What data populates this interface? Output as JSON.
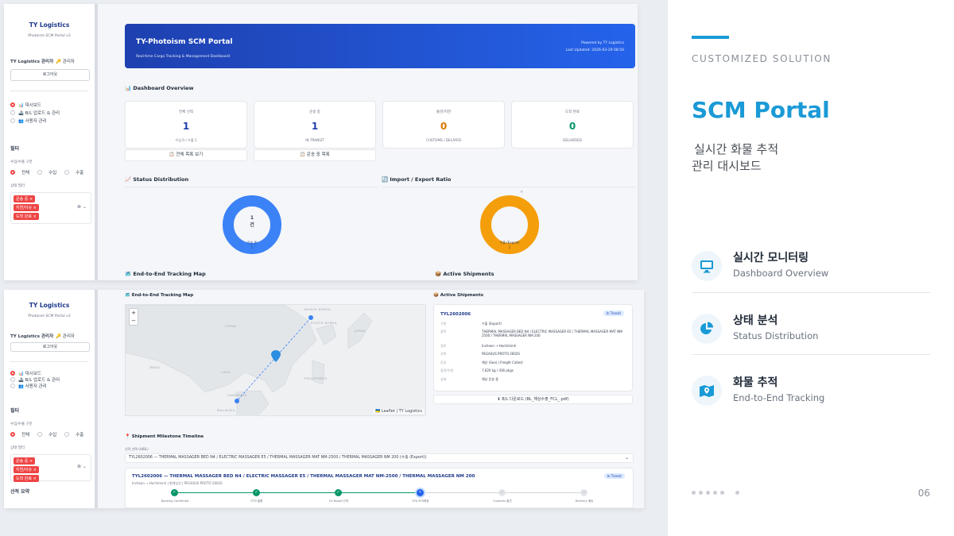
{
  "slide": {
    "eyebrow": "CUSTOMIZED SOLUTION",
    "title": "SCM Portal",
    "desc_line1": "실시간 화물 추적",
    "desc_line2": "관리 대시보드",
    "page_number": "06",
    "accent_color": "#1a9ad6",
    "features": [
      {
        "icon": "monitor-icon",
        "title": "실시간 모니터링",
        "subtitle": "Dashboard Overview"
      },
      {
        "icon": "pie-chart-icon",
        "title": "상태 분석",
        "subtitle": "Status Distribution"
      },
      {
        "icon": "map-icon",
        "title": "화물 추적",
        "subtitle": "End-to-End Tracking"
      }
    ]
  },
  "sidebar": {
    "brand": "TY Logistics",
    "subtitle": "Photoism SCM Portal v3",
    "subtitle2": "Photoism SCM Portal v3",
    "user": "TY Logistics 관리자",
    "role": "🔑 관리자",
    "logout": "로그아웃",
    "nav": [
      "📊 대시보드",
      "🚢 B/L 업로드 & 관리",
      "👥 사용자 관리"
    ],
    "filter_title": "필터",
    "io_label": "수입/수출 구분",
    "io_options": [
      "전체",
      "수입",
      "수출"
    ],
    "status_label": "상태 필터",
    "status_tags": [
      "운송 중 ×",
      "지연/이슈 ×",
      "도착 완료 ×"
    ],
    "next_section": "선적 요약"
  },
  "dashboard": {
    "banner_title": "TY-Photoism SCM Portal",
    "banner_subtitle": "Real-time Cargo Tracking & Management Dashboard",
    "powered_by": "Powered by TY Logistics",
    "last_updated": "Last Updated: 2026-03-29 08:50",
    "overview_title": "📊 Dashboard Overview",
    "cards": [
      {
        "label": "전체 선적",
        "value": "1",
        "sub": "수입 0 / 수출 1"
      },
      {
        "label": "운송 중",
        "value": "1",
        "sub": "IN TRANSIT"
      },
      {
        "label": "통관/지연",
        "value": "0",
        "sub": "CUSTOMS / DELAYED"
      },
      {
        "label": "도착 완료",
        "value": "0",
        "sub": "DELIVERED"
      }
    ],
    "btn_all": "📋 전체 목록 보기",
    "btn_transit": "📋 운송 중 목록",
    "status_title": "📈 Status Distribution",
    "ratio_title": "🔄 Import / Export Ratio",
    "donut_center_top": "1",
    "donut_center_bottom": "건",
    "donut1_slice": "운송 중",
    "donut1_slice_val": "1",
    "donut2_slice": "수출 (Export)",
    "donut2_slice_val": "1",
    "donut2_x": "×",
    "map_title": "🗺️ End-to-End Tracking Map",
    "active_title": "📦 Active Shipments"
  },
  "tracking": {
    "map_title": "🗺️ End-to-End Tracking Map",
    "active_title": "📦 Active Shipments",
    "map_labels": [
      "NORTH KOREA",
      "SOUTH KOREA",
      "CHINA",
      "JAPAN",
      "INDIA",
      "LAOS",
      "CAMBODIA",
      "MALAYSIA",
      "PHILIPPINES"
    ],
    "attribution": "🇺🇦 Leaflet | TY Logistics",
    "shipment": {
      "id": "TYL2602006",
      "badge": "In Transit",
      "rows": [
        {
          "k": "구분",
          "v": "수출 (Export)"
        },
        {
          "k": "품목",
          "v": "THERMAL MASSAGER BED N4 / ELECTRIC MASSAGER E5 / THERMAL MASSAGER MAT NM-2500 / THERMAL MASSAGER NM 200"
        },
        {
          "k": "경로",
          "v": "Incheon → Hochiminh"
        },
        {
          "k": "선박",
          "v": "PEGASUS PROTO 2602S"
        },
        {
          "k": "운송",
          "v": "해상 (Sea) | Freight Collect"
        },
        {
          "k": "중량/수량",
          "v": "7,620 kg / 436 pkgs"
        },
        {
          "k": "상태",
          "v": "해상 운송 중"
        }
      ]
    },
    "download_btn": "⬇ B/L 다운로드 (BL_해상수출_FCL_.pdf)",
    "timeline_title": "📍 Shipment Milestone Timeline",
    "select_label": "선적 선택 (H/BL)",
    "select_value": "TYL2602006 — THERMAL MASSAGER BED N4 / ELECTRIC MASSAGER E5 / THERMAL MASSAGER MAT NM-2500 / THERMAL MASSAGER NM 200 (수출 (Export))",
    "tl_title": "TYL2602006 — THERMAL MASSAGER BED N4 / ELECTRIC MASSAGER E5 / THERMAL MASSAGER MAT NM-2500 / THERMAL MASSAGER NM 200",
    "tl_sub": "Incheon → Hochiminh | 현대상선 | PEGASUS PROTO 2602S",
    "tl_badge": "In Transit",
    "steps": [
      {
        "label": "Booking Confirmed",
        "state": "done"
      },
      {
        "label": "ETD 출항",
        "state": "done"
      },
      {
        "label": "On Board 선적",
        "state": "done"
      },
      {
        "label": "ETA 도착예정",
        "state": "cur"
      },
      {
        "label": "Customs 통관",
        "state": "todo"
      },
      {
        "label": "Delivery 배송",
        "state": "todo"
      }
    ]
  }
}
